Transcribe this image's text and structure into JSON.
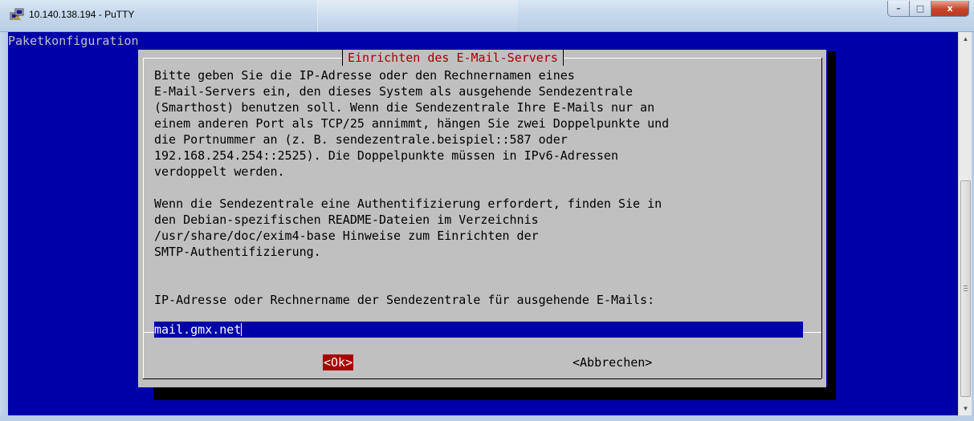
{
  "window": {
    "title": "10.140.138.194 - PuTTY",
    "app_icon": "putty-icon",
    "caption_buttons": {
      "minimize": "–",
      "maximize": "□",
      "close": "x"
    }
  },
  "terminal": {
    "backtitle": "Paketkonfiguration",
    "colors": {
      "background": "#0000a8",
      "dialog": "#c0c0c0",
      "title": "#a80000",
      "selected_button": "#a80000"
    }
  },
  "dialog": {
    "title": "Einrichten des E-Mail-Servers",
    "text": "Bitte geben Sie die IP-Adresse oder den Rechnernamen eines\nE-Mail-Servers ein, den dieses System als ausgehende Sendezentrale\n(Smarthost) benutzen soll. Wenn die Sendezentrale Ihre E-Mails nur an\neinem anderen Port als TCP/25 annimmt, hängen Sie zwei Doppelpunkte und\ndie Portnummer an (z. B. sendezentrale.beispiel::587 oder\n192.168.254.254::2525). Die Doppelpunkte müssen in IPv6-Adressen\nverdoppelt werden.\n\nWenn die Sendezentrale eine Authentifizierung erfordert, finden Sie in\nden Debian-spezifischen README-Dateien im Verzeichnis\n/usr/share/doc/exim4-base Hinweise zum Einrichten der\nSMTP-Authentifizierung.",
    "prompt": "IP-Adresse oder Rechnername der Sendezentrale für ausgehende E-Mails:",
    "input_value": "mail.gmx.net",
    "ok_label": "<Ok>",
    "cancel_label": "<Abbrechen>"
  }
}
